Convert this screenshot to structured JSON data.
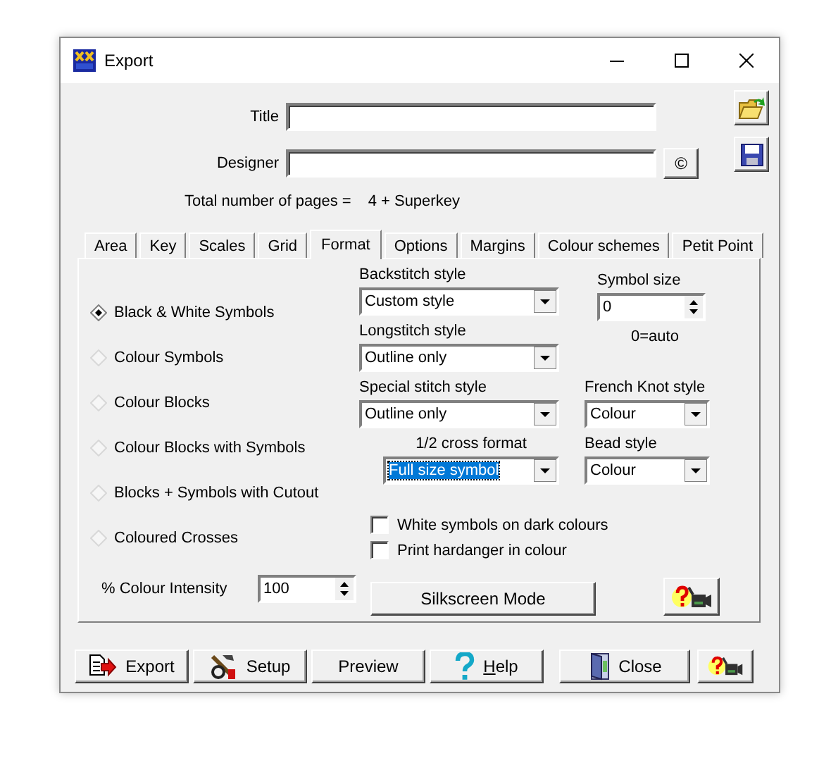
{
  "window": {
    "title": "Export"
  },
  "fields": [
    {
      "label": "Title"
    },
    {
      "label": "Designer"
    }
  ],
  "copyright_button": "©",
  "total_pages": {
    "label": "Total number of pages =",
    "value": "4 + Superkey"
  },
  "tabs": [
    {
      "label": "Area",
      "selected": false
    },
    {
      "label": "Key",
      "selected": false
    },
    {
      "label": "Scales",
      "selected": false
    },
    {
      "label": "Grid",
      "selected": false
    },
    {
      "label": "Format",
      "selected": true
    },
    {
      "label": "Options",
      "selected": false
    },
    {
      "label": "Margins",
      "selected": false
    },
    {
      "label": "Colour schemes",
      "selected": false
    },
    {
      "label": "Petit Point",
      "selected": false
    }
  ],
  "format": {
    "options": [
      {
        "label": "Black & White Symbols",
        "selected": true
      },
      {
        "label": "Colour Symbols",
        "selected": false
      },
      {
        "label": "Colour Blocks",
        "selected": false
      },
      {
        "label": "Colour Blocks with Symbols",
        "selected": false
      },
      {
        "label": "Blocks + Symbols with Cutout",
        "selected": false
      },
      {
        "label": "Coloured Crosses",
        "selected": false
      }
    ],
    "intensity": {
      "label": "% Colour Intensity",
      "value": "100"
    },
    "dropdowns": [
      {
        "label": "Backstitch style",
        "value": "Custom style",
        "focused": false
      },
      {
        "label": "Longstitch style",
        "value": "Outline only",
        "focused": false
      },
      {
        "label": "Special stitch style",
        "value": "Outline only",
        "focused": false
      },
      {
        "label": "1/2 cross format",
        "value": "Full size symbol",
        "focused": true
      }
    ],
    "symbol_size": {
      "label": "Symbol size",
      "value": "0",
      "note": "0=auto"
    },
    "side_dropdowns": [
      {
        "label": "French Knot style",
        "value": "Colour"
      },
      {
        "label": "Bead style",
        "value": "Colour"
      }
    ],
    "checkboxes": [
      {
        "label": "White symbols on dark colours",
        "checked": false
      },
      {
        "label": "Print hardanger in colour",
        "checked": false
      }
    ],
    "silkscreen_button": "Silkscreen Mode"
  },
  "buttons": [
    {
      "label": "Export",
      "kind": "export",
      "mnemonic": false
    },
    {
      "label": "Setup",
      "kind": "setup",
      "mnemonic": false
    },
    {
      "label": "Preview",
      "kind": "plain",
      "mnemonic": false
    },
    {
      "label": "Help",
      "kind": "help",
      "mnemonic": true
    },
    {
      "label": "Close",
      "kind": "close",
      "mnemonic": false
    },
    {
      "kind": "video-help"
    }
  ]
}
